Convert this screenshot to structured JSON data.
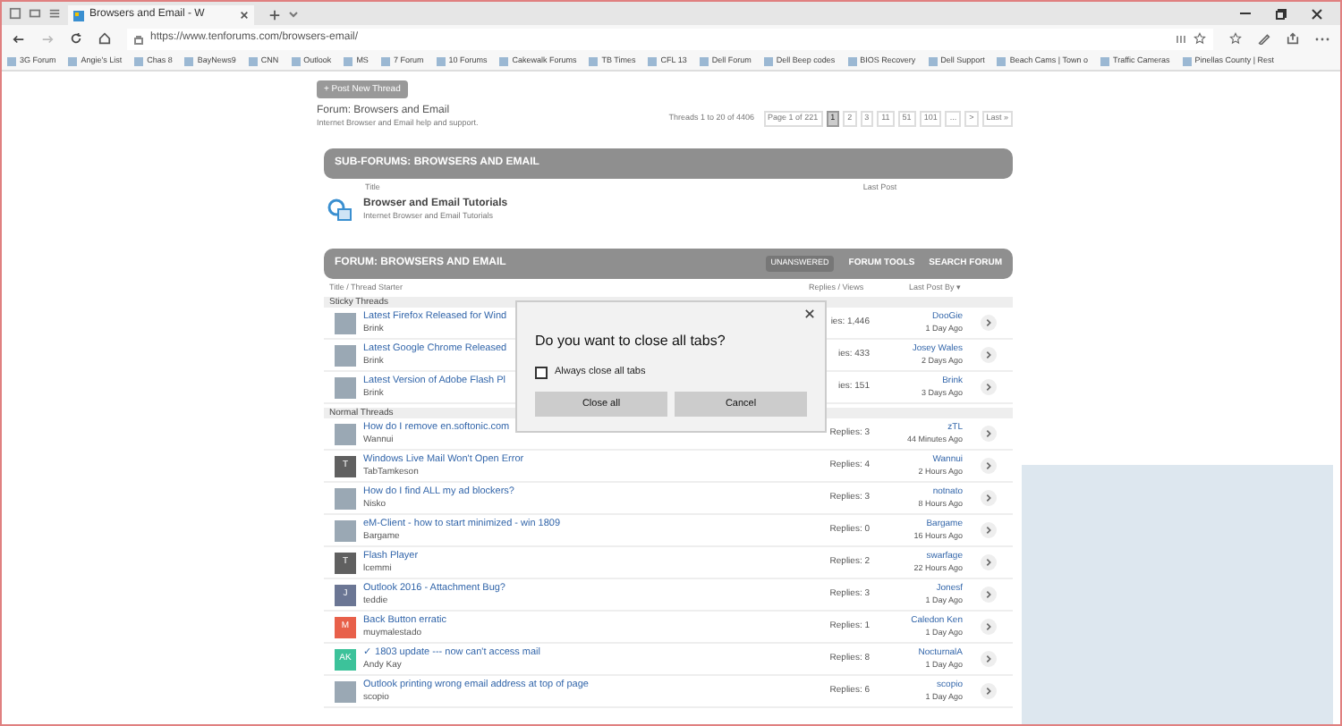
{
  "browser": {
    "tab_title": "Browsers and Email - W",
    "url": "https://www.tenforums.com/browsers-email/",
    "bookmarks": [
      "3G Forum",
      "Angie's List",
      "Chas 8",
      "BayNews9",
      "CNN",
      "Outlook",
      "MS",
      "7 Forum",
      "10 Forums",
      "Cakewalk Forums",
      "TB Times",
      "CFL 13",
      "Dell Forum",
      "Dell Beep codes",
      "BIOS Recovery",
      "Dell Support",
      "Beach Cams | Town o",
      "Traffic Cameras",
      "Pinellas County | Rest"
    ]
  },
  "page": {
    "post_button": "+ Post New Thread",
    "forum_title": "Forum: Browsers and Email",
    "forum_subtitle": "Internet Browser and Email help and support.",
    "thread_count": "Threads 1 to 20 of 4406",
    "pagination": [
      {
        "label": "Page 1 of 221",
        "selected": false
      },
      {
        "label": "1",
        "selected": true
      },
      {
        "label": "2",
        "selected": false
      },
      {
        "label": "3",
        "selected": false
      },
      {
        "label": "11",
        "selected": false
      },
      {
        "label": "51",
        "selected": false
      },
      {
        "label": "101",
        "selected": false
      },
      {
        "label": "...",
        "selected": false
      },
      {
        "label": ">",
        "selected": false
      },
      {
        "label": "Last »",
        "selected": false
      }
    ],
    "subforum_header": "SUB-FORUMS: BROWSERS AND EMAIL",
    "subforum_columns": [
      "Title",
      "Last Post"
    ],
    "subforum": {
      "title": "Browser and Email Tutorials",
      "description": "Internet Browser and Email Tutorials"
    },
    "forum_header": "FORUM: BROWSERS AND EMAIL",
    "forum_links": [
      "UNANSWERED",
      "FORUM TOOLS",
      "SEARCH FORUM"
    ],
    "thread_columns": [
      "Title / Thread Starter",
      "Replies / Views",
      "Last Post By ▾"
    ],
    "sections": [
      {
        "label": "Sticky Threads",
        "threads": [
          {
            "title": "Latest Firefox Released for Wind",
            "author": "Brink",
            "replies": "ies: 1,446",
            "last_by": "DooGie",
            "last_time": "1 Day Ago",
            "avatar": {
              "kind": "image"
            }
          },
          {
            "title": "Latest Google Chrome Released",
            "author": "Brink",
            "replies": "ies: 433",
            "last_by": "Josey Wales",
            "last_time": "2 Days Ago",
            "avatar": {
              "kind": "image"
            }
          },
          {
            "title": "Latest Version of Adobe Flash Pl",
            "author": "Brink",
            "replies": "ies: 151",
            "last_by": "Brink",
            "last_time": "3 Days Ago",
            "avatar": {
              "kind": "image"
            }
          }
        ]
      },
      {
        "label": "Normal Threads",
        "threads": [
          {
            "title": "How do I remove en.softonic.com",
            "author": "Wannui",
            "replies": "Replies: 3",
            "last_by": "zTL",
            "last_time": "44 Minutes Ago",
            "avatar": {
              "kind": "image"
            }
          },
          {
            "title": "Windows Live Mail Won't Open Error",
            "author": "TabTamkeson",
            "replies": "Replies: 4",
            "last_by": "Wannui",
            "last_time": "2 Hours Ago",
            "avatar": {
              "kind": "letter",
              "letter": "T",
              "color": "#606060"
            }
          },
          {
            "title": "How do I find ALL my ad blockers?",
            "author": "Nisko",
            "replies": "Replies: 3",
            "last_by": "notnato",
            "last_time": "8 Hours Ago",
            "avatar": {
              "kind": "image"
            }
          },
          {
            "title": "eM-Client - how to start minimized - win 1809",
            "author": "Bargame",
            "replies": "Replies: 0",
            "last_by": "Bargame",
            "last_time": "16 Hours Ago",
            "avatar": {
              "kind": "image"
            }
          },
          {
            "title": "Flash Player",
            "author": "lcemmi",
            "replies": "Replies: 2",
            "last_by": "swarfage",
            "last_time": "22 Hours Ago",
            "avatar": {
              "kind": "letter",
              "letter": "T",
              "color": "#606060"
            }
          },
          {
            "title": "Outlook 2016 - Attachment Bug?",
            "author": "teddie",
            "replies": "Replies: 3",
            "last_by": "Jonesf",
            "last_time": "1 Day Ago",
            "avatar": {
              "kind": "letter",
              "letter": "J",
              "color": "#6b7694"
            }
          },
          {
            "title": "Back Button erratic",
            "author": "muymalestado",
            "replies": "Replies: 1",
            "last_by": "Caledon Ken",
            "last_time": "1 Day Ago",
            "avatar": {
              "kind": "letter",
              "letter": "M",
              "color": "#e8604a"
            }
          },
          {
            "title": "✓ 1803 update --- now can't access mail",
            "author": "Andy Kay",
            "replies": "Replies: 8",
            "last_by": "NocturnalA",
            "last_time": "1 Day Ago",
            "avatar": {
              "kind": "letter",
              "letter": "AK",
              "color": "#3cc29a"
            }
          },
          {
            "title": "Outlook printing wrong email address at top of page",
            "author": "scopio",
            "replies": "Replies: 6",
            "last_by": "scopio",
            "last_time": "1 Day Ago",
            "avatar": {
              "kind": "image"
            }
          }
        ]
      }
    ]
  },
  "dialog": {
    "title": "Do you want to close all tabs?",
    "checkbox": {
      "label": "Always close all tabs",
      "checked": false
    },
    "buttons": [
      "Close all",
      "Cancel"
    ]
  }
}
